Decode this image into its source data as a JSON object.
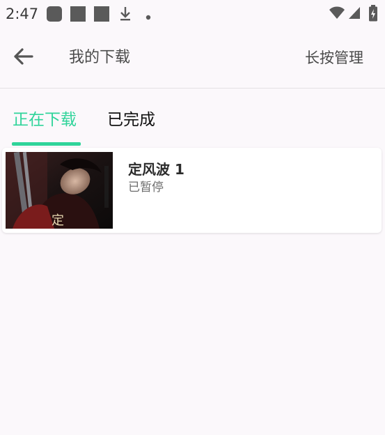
{
  "status_bar": {
    "time": "2:47"
  },
  "header": {
    "title": "我的下载",
    "manage_label": "长按管理"
  },
  "tabs": [
    {
      "label": "正在下载",
      "active": true
    },
    {
      "label": "已完成",
      "active": false
    }
  ],
  "downloads": [
    {
      "title": "定风波 1",
      "status": "已暂停"
    }
  ],
  "colors": {
    "accent": "#2fd49a",
    "background": "#fbf8fb"
  }
}
